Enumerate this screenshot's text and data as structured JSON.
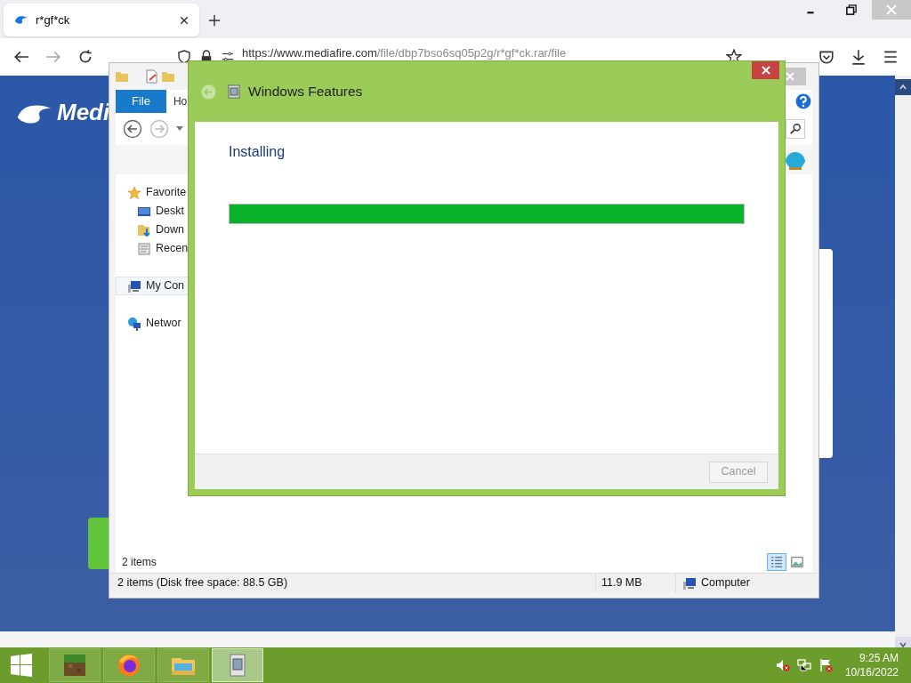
{
  "browser": {
    "tabs": [
      {
        "title": "r*gf*ck",
        "selected": true
      }
    ],
    "url_host": "https://www.mediafire.com",
    "url_path": "/file/dbp7bso6sq05p2g/r*gf*ck.rar/file"
  },
  "page": {
    "logo_text": "Medi"
  },
  "explorer": {
    "ribbon_tabs": [
      {
        "label": "File",
        "selected": true
      },
      {
        "label": "Ho",
        "selected": false
      }
    ],
    "nav": [
      {
        "label": "Favorite",
        "kind": "star",
        "children": [
          {
            "label": "Deskt",
            "kind": "desktop"
          },
          {
            "label": "Down",
            "kind": "downloads"
          },
          {
            "label": "Recen",
            "kind": "recent"
          }
        ]
      },
      {
        "label": "My Con",
        "kind": "computer",
        "selected": true
      },
      {
        "label": "Networ",
        "kind": "network",
        "selected": false
      }
    ],
    "item_count": "2 items",
    "status": [
      "2 items (Disk free space: 88.5 GB)",
      "11.9 MB",
      "Computer"
    ]
  },
  "dialog": {
    "title": "Windows Features",
    "heading": "Installing",
    "progress": {
      "level": 1
    },
    "cancel": {
      "label": "Cancel",
      "disabled": true
    }
  },
  "taskbar": {
    "apps": [
      {
        "kind": "minecraft",
        "selected": false
      },
      {
        "kind": "firefox",
        "selected": false
      },
      {
        "kind": "explorer",
        "selected": false
      },
      {
        "kind": "features",
        "selected": true
      }
    ],
    "time": "9:25 AM",
    "date": "10/16/2022"
  }
}
